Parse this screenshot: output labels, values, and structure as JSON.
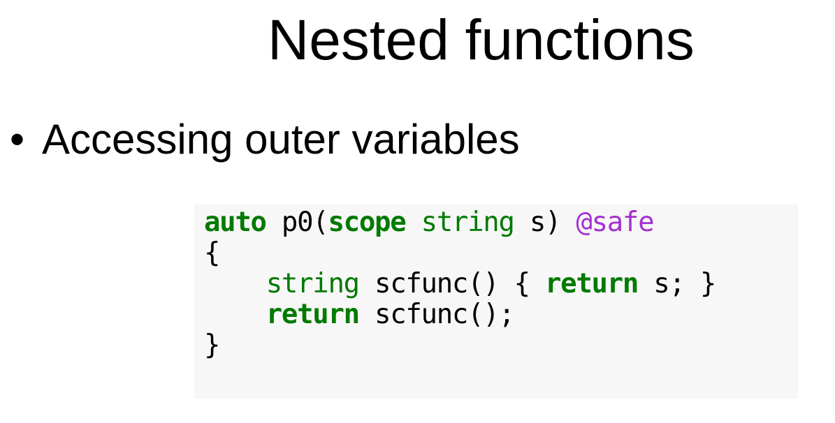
{
  "slide": {
    "title": "Nested functions",
    "bullet": "Accessing outer variables",
    "bullet_symbol": "•"
  },
  "code": {
    "colors": {
      "keyword": "#007a00",
      "type": "#007a00",
      "attribute": "#a52fd1",
      "background": "#f7f7f7"
    },
    "lines": [
      [
        {
          "text": "auto",
          "kind": "kw"
        },
        {
          "text": " p0(",
          "kind": "plain"
        },
        {
          "text": "scope",
          "kind": "kw"
        },
        {
          "text": " ",
          "kind": "plain"
        },
        {
          "text": "string",
          "kind": "ty"
        },
        {
          "text": " s) ",
          "kind": "plain"
        },
        {
          "text": "@safe",
          "kind": "at"
        }
      ],
      [
        {
          "text": "{",
          "kind": "plain"
        }
      ],
      [
        {
          "text": "    ",
          "kind": "plain"
        },
        {
          "text": "string",
          "kind": "ty"
        },
        {
          "text": " scfunc() { ",
          "kind": "plain"
        },
        {
          "text": "return",
          "kind": "kw"
        },
        {
          "text": " s; }",
          "kind": "plain"
        }
      ],
      [
        {
          "text": "    ",
          "kind": "plain"
        },
        {
          "text": "return",
          "kind": "kw"
        },
        {
          "text": " scfunc();",
          "kind": "plain"
        }
      ],
      [
        {
          "text": "}",
          "kind": "plain"
        }
      ]
    ]
  }
}
